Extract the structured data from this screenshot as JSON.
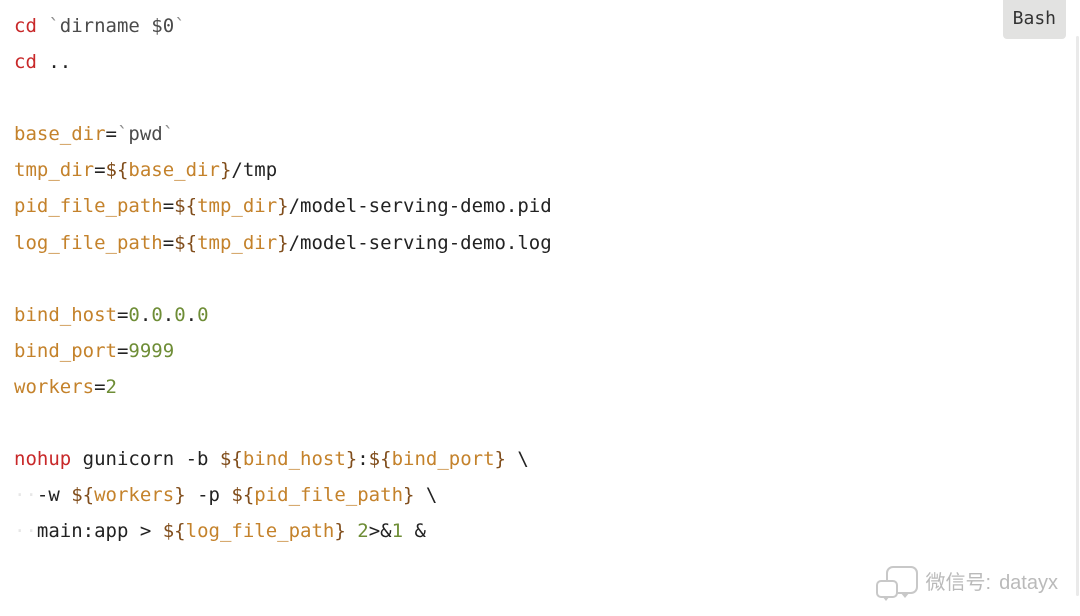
{
  "badge": "Bash",
  "lines": [
    [
      {
        "t": "cd",
        "c": "red"
      },
      {
        "t": " ",
        "c": "blk"
      },
      {
        "t": "`",
        "c": "grey"
      },
      {
        "t": "dirname $0",
        "c": "text"
      },
      {
        "t": "`",
        "c": "grey"
      }
    ],
    [
      {
        "t": "cd",
        "c": "red"
      },
      {
        "t": " ..",
        "c": "blk"
      }
    ],
    [],
    [
      {
        "t": "base_dir",
        "c": "orange"
      },
      {
        "t": "=",
        "c": "blk"
      },
      {
        "t": "`",
        "c": "grey"
      },
      {
        "t": "pwd",
        "c": "text"
      },
      {
        "t": "`",
        "c": "grey"
      }
    ],
    [
      {
        "t": "tmp_dir",
        "c": "orange"
      },
      {
        "t": "=",
        "c": "blk"
      },
      {
        "t": "${",
        "c": "brown"
      },
      {
        "t": "base_dir",
        "c": "orange"
      },
      {
        "t": "}",
        "c": "brown"
      },
      {
        "t": "/tmp",
        "c": "blk"
      }
    ],
    [
      {
        "t": "pid_file_path",
        "c": "orange"
      },
      {
        "t": "=",
        "c": "blk"
      },
      {
        "t": "${",
        "c": "brown"
      },
      {
        "t": "tmp_dir",
        "c": "orange"
      },
      {
        "t": "}",
        "c": "brown"
      },
      {
        "t": "/model-serving-demo.pid",
        "c": "blk"
      }
    ],
    [
      {
        "t": "log_file_path",
        "c": "orange"
      },
      {
        "t": "=",
        "c": "blk"
      },
      {
        "t": "${",
        "c": "brown"
      },
      {
        "t": "tmp_dir",
        "c": "orange"
      },
      {
        "t": "}",
        "c": "brown"
      },
      {
        "t": "/model-serving-demo.log",
        "c": "blk"
      }
    ],
    [],
    [
      {
        "t": "bind_host",
        "c": "orange"
      },
      {
        "t": "=",
        "c": "blk"
      },
      {
        "t": "0",
        "c": "green"
      },
      {
        "t": ".",
        "c": "blk"
      },
      {
        "t": "0",
        "c": "green"
      },
      {
        "t": ".",
        "c": "blk"
      },
      {
        "t": "0",
        "c": "green"
      },
      {
        "t": ".",
        "c": "blk"
      },
      {
        "t": "0",
        "c": "green"
      }
    ],
    [
      {
        "t": "bind_port",
        "c": "orange"
      },
      {
        "t": "=",
        "c": "blk"
      },
      {
        "t": "9999",
        "c": "green"
      }
    ],
    [
      {
        "t": "workers",
        "c": "orange"
      },
      {
        "t": "=",
        "c": "blk"
      },
      {
        "t": "2",
        "c": "green"
      }
    ],
    [],
    [
      {
        "t": "nohup",
        "c": "red"
      },
      {
        "t": " gunicorn -b ",
        "c": "blk"
      },
      {
        "t": "${",
        "c": "brown"
      },
      {
        "t": "bind_host",
        "c": "orange"
      },
      {
        "t": "}",
        "c": "brown"
      },
      {
        "t": ":",
        "c": "blk"
      },
      {
        "t": "${",
        "c": "brown"
      },
      {
        "t": "bind_port",
        "c": "orange"
      },
      {
        "t": "}",
        "c": "brown"
      },
      {
        "t": " \\",
        "c": "blk"
      }
    ],
    [
      {
        "t": "··",
        "c": "ws"
      },
      {
        "t": "-w ",
        "c": "blk"
      },
      {
        "t": "${",
        "c": "brown"
      },
      {
        "t": "workers",
        "c": "orange"
      },
      {
        "t": "}",
        "c": "brown"
      },
      {
        "t": " -p ",
        "c": "blk"
      },
      {
        "t": "${",
        "c": "brown"
      },
      {
        "t": "pid_file_path",
        "c": "orange"
      },
      {
        "t": "}",
        "c": "brown"
      },
      {
        "t": " \\",
        "c": "blk"
      }
    ],
    [
      {
        "t": "··",
        "c": "ws"
      },
      {
        "t": "main:app > ",
        "c": "blk"
      },
      {
        "t": "${",
        "c": "brown"
      },
      {
        "t": "log_file_path",
        "c": "orange"
      },
      {
        "t": "}",
        "c": "brown"
      },
      {
        "t": " ",
        "c": "blk"
      },
      {
        "t": "2",
        "c": "green"
      },
      {
        "t": ">&",
        "c": "blk"
      },
      {
        "t": "1",
        "c": "green"
      },
      {
        "t": " &",
        "c": "blk"
      }
    ]
  ],
  "watermark": {
    "label": "微信号:",
    "value": "datayx"
  }
}
